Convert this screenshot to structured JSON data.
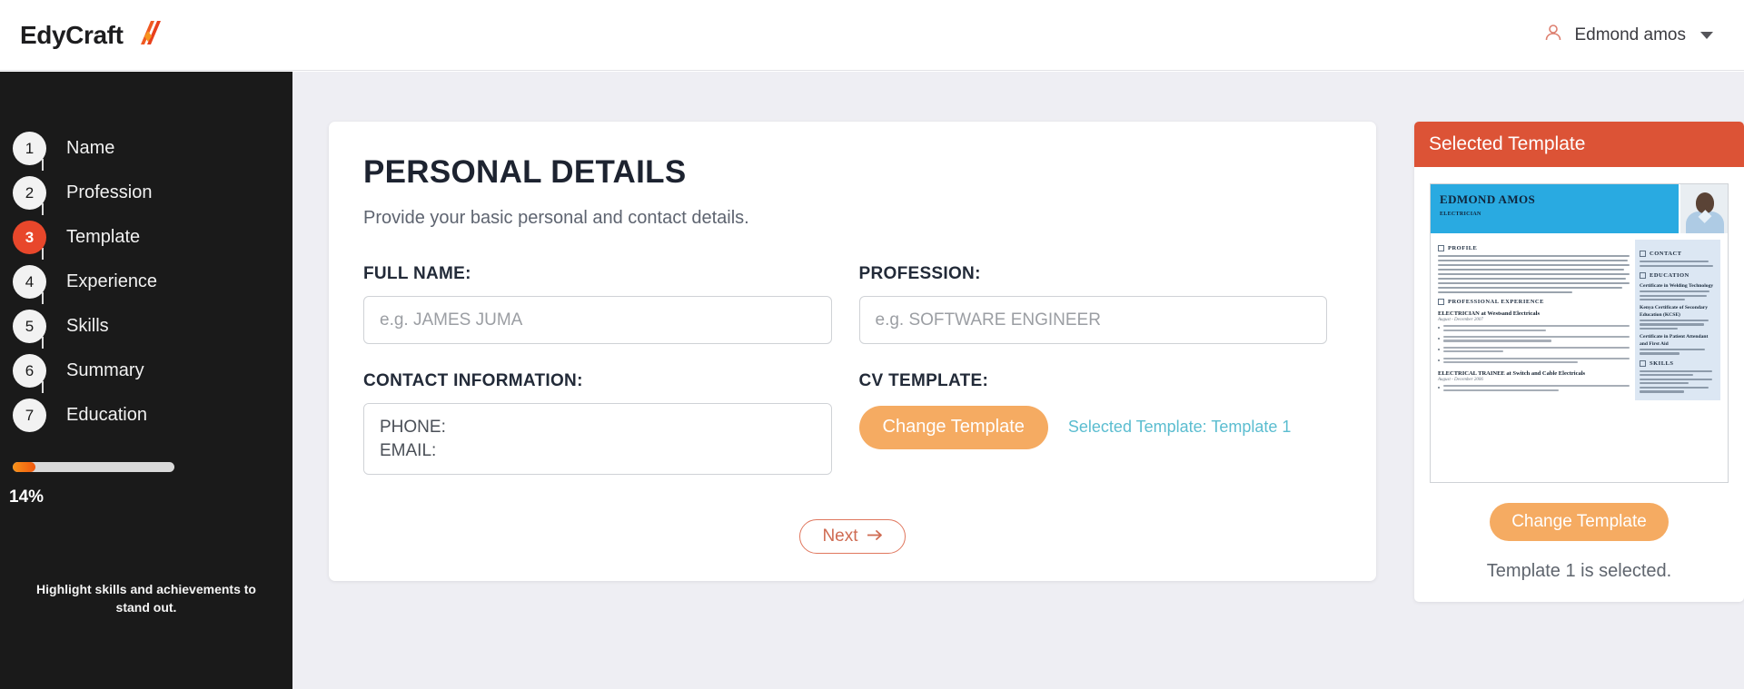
{
  "header": {
    "brand_name": "EdyCraft",
    "brand_mark_icon": "edycraft-logo-mark",
    "user_icon": "user-account-icon",
    "user_name": "Edmond amos",
    "caret_icon": "chevron-down-icon"
  },
  "sidebar": {
    "steps": [
      {
        "number": "1",
        "label": "Name",
        "active": false
      },
      {
        "number": "2",
        "label": "Profession",
        "active": false
      },
      {
        "number": "3",
        "label": "Template",
        "active": true
      },
      {
        "number": "4",
        "label": "Experience",
        "active": false
      },
      {
        "number": "5",
        "label": "Skills",
        "active": false
      },
      {
        "number": "6",
        "label": "Summary",
        "active": false
      },
      {
        "number": "7",
        "label": "Education",
        "active": false
      }
    ],
    "progress_percent_label": "14%",
    "progress_percent_value": 14,
    "tip": "Highlight skills and achievements to stand out.",
    "active_color": "#e8472b",
    "background_color": "#1a1a1a"
  },
  "form": {
    "title": "PERSONAL DETAILS",
    "subtitle": "Provide your basic personal and contact details.",
    "full_name": {
      "label": "FULL NAME:",
      "placeholder": "e.g. JAMES JUMA",
      "value": ""
    },
    "profession": {
      "label": "PROFESSION:",
      "placeholder": "e.g. SOFTWARE ENGINEER",
      "value": ""
    },
    "contact_information": {
      "label": "CONTACT INFORMATION:",
      "value": "PHONE:\nEMAIL:"
    },
    "cv_template": {
      "label": "CV TEMPLATE:",
      "change_button_label": "Change Template",
      "selected_note": "Selected Template: Template 1",
      "note_color": "#5bbdd0",
      "button_color": "#f5ab62"
    },
    "next_button": {
      "label": "Next",
      "arrow_icon": "arrow-right-icon",
      "color": "#cf6b52"
    }
  },
  "preview": {
    "panel_title": "Selected Template",
    "panel_title_bg": "#dc5336",
    "change_button_label": "Change Template",
    "status_text": "Template 1 is selected.",
    "cv": {
      "name": "EDMOND AMOS",
      "role": "ELECTRICIAN",
      "photo_icon": "portrait-photo",
      "header_color": "#29aae1",
      "sections": {
        "profile_heading": "PROFILE",
        "experience_heading": "PROFESSIONAL EXPERIENCE",
        "contact_heading": "CONTACT",
        "education_heading": "EDUCATION",
        "skills_heading": "SKILLS"
      },
      "jobs": [
        {
          "title": "ELECTRICIAN at Westsand Electricals",
          "date": "August - December 2007"
        },
        {
          "title": "ELECTRICAL TRAINEE at Switch and Cable Electricals",
          "date": "August - December 2006"
        }
      ],
      "education": [
        {
          "title": "Certificate in Welding Technology",
          "detail": "institutes of Engineering Technologists and Technicians of Kenya"
        },
        {
          "title": "Kenya Certificate of Secondary Education (KCSE)",
          "detail": "United Nation Agency for International Development (UNAIDS)"
        },
        {
          "title": "Certificate in Patient Attendant and First Aid",
          "detail": "Nairobi Equator Hospital"
        }
      ]
    }
  }
}
